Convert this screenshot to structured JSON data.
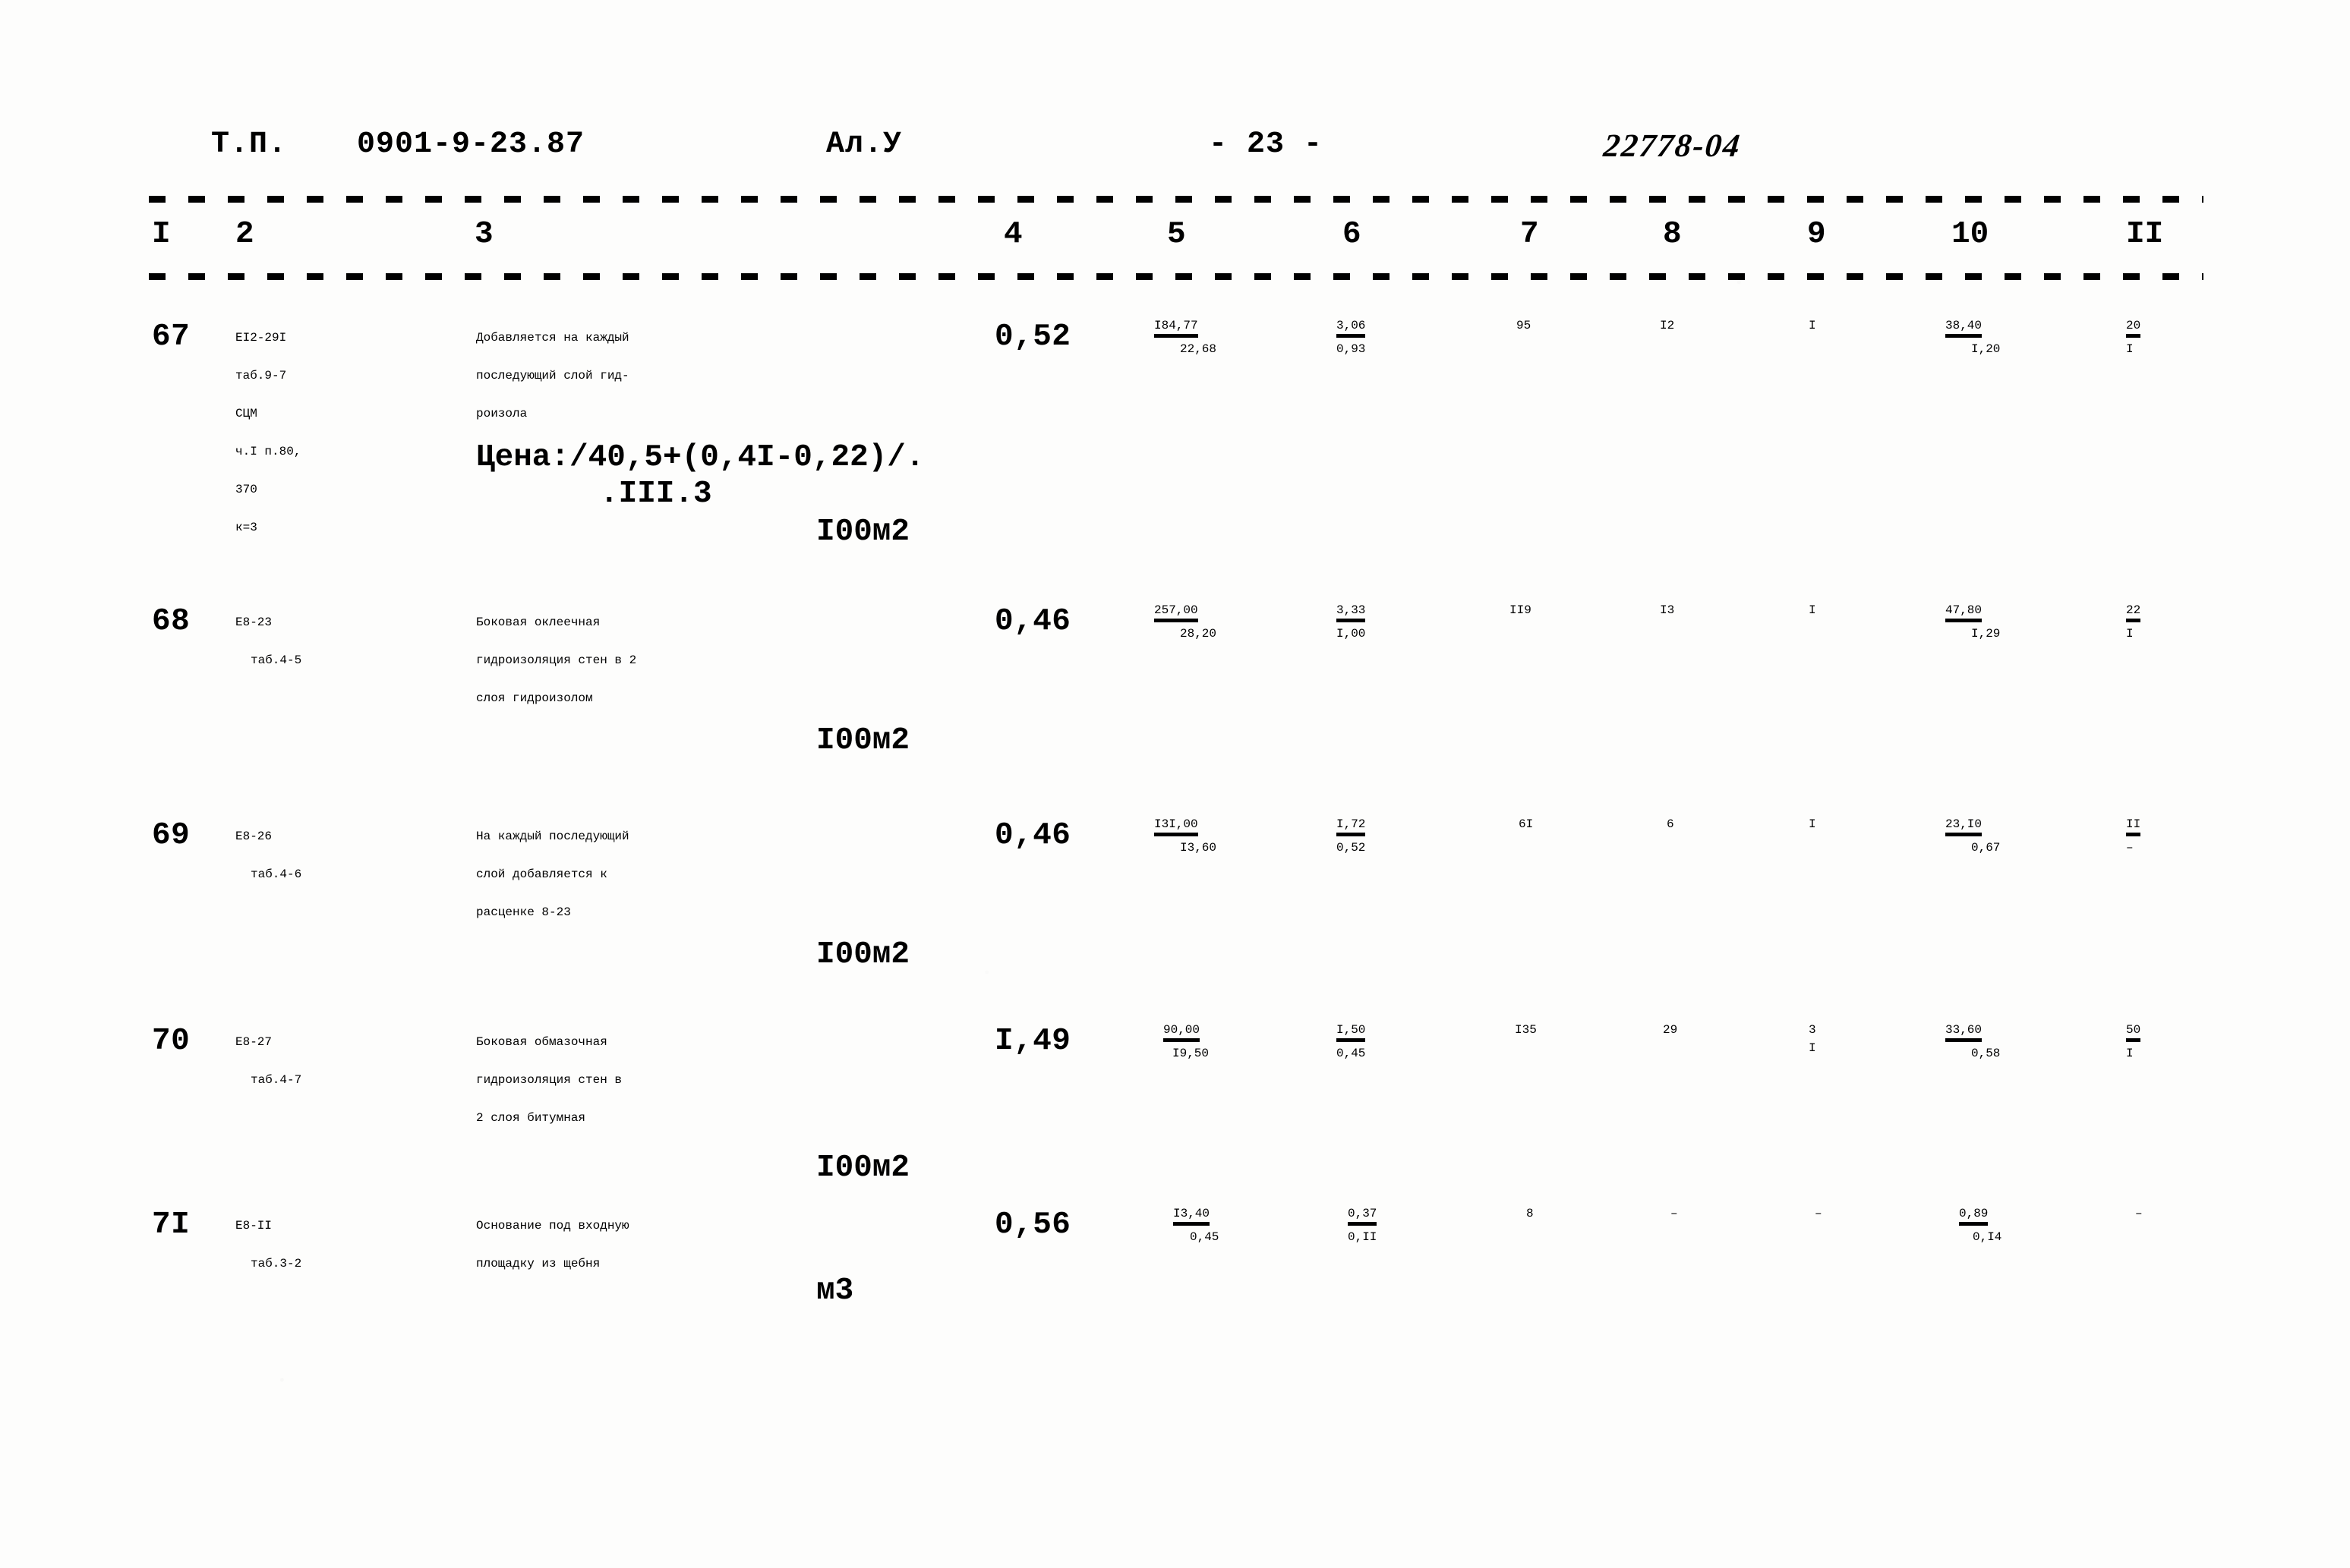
{
  "document": {
    "type_label": "Т.П.",
    "project_code": "0901-9-23.87",
    "album": "Ал.У",
    "page_marker": "- 23 -",
    "archive_stamp": "22778-04"
  },
  "table": {
    "column_numbers": [
      "I",
      "2",
      "3",
      "4",
      "5",
      "6",
      "7",
      "8",
      "9",
      "10",
      "II"
    ],
    "rows": [
      {
        "no": "67",
        "code_lines": [
          "ЕI2-29I",
          "таб.9-7",
          "СЦМ",
          "ч.I п.80,",
          "370",
          "к=3"
        ],
        "description_lines": [
          "Добавляется на каждый",
          "последующий слой гид-",
          "роизола"
        ],
        "price_note": "Цена:/40,5+(0,4I-0,22)/.",
        "price_note2": ".III.3",
        "unit": "I00м2",
        "c4": "0,52",
        "c5_top": "I84,77",
        "c5_bot": "22,68",
        "c6_top": "3,06",
        "c6_bot": "0,93",
        "c7_top": "95",
        "c7_bot": "",
        "c8_top": "I2",
        "c8_bot": "",
        "c9_top": "I",
        "c9_bot": "",
        "c10_top": "38,40",
        "c10_bot": "I,20",
        "c11_top": "20",
        "c11_bot": "I"
      },
      {
        "no": "68",
        "code_lines": [
          "Е8-23",
          "таб.4-5"
        ],
        "description_lines": [
          "Боковая оклеечная",
          "гидроизоляция стен в 2",
          "слоя гидроизолом"
        ],
        "price_note": "",
        "price_note2": "",
        "unit": "I00м2",
        "c4": "0,46",
        "c5_top": "257,00",
        "c5_bot": "28,20",
        "c6_top": "3,33",
        "c6_bot": "I,00",
        "c7_top": "II9",
        "c7_bot": "",
        "c8_top": "I3",
        "c8_bot": "",
        "c9_top": "I",
        "c9_bot": "",
        "c10_top": "47,80",
        "c10_bot": "I,29",
        "c11_top": "22",
        "c11_bot": "I"
      },
      {
        "no": "69",
        "code_lines": [
          "Е8-26",
          "таб.4-6"
        ],
        "description_lines": [
          "На каждый последующий",
          "слой добавляется к",
          "расценке 8-23"
        ],
        "price_note": "",
        "price_note2": "",
        "unit": "I00м2",
        "c4": "0,46",
        "c5_top": "I3I,00",
        "c5_bot": "I3,60",
        "c6_top": "I,72",
        "c6_bot": "0,52",
        "c7_top": "6I",
        "c7_bot": "",
        "c8_top": "6",
        "c8_bot": "",
        "c9_top": "I",
        "c9_bot": "",
        "c10_top": "23,I0",
        "c10_bot": "0,67",
        "c11_top": "II",
        "c11_bot": "–"
      },
      {
        "no": "70",
        "code_lines": [
          "Е8-27",
          "таб.4-7"
        ],
        "description_lines": [
          "Боковая обмазочная",
          "гидроизоляция стен в",
          "2 слоя битумная"
        ],
        "price_note": "",
        "price_note2": "",
        "unit": "I00м2",
        "c4": "I,49",
        "c5_top": "90,00",
        "c5_bot": "I9,50",
        "c6_top": "I,50",
        "c6_bot": "0,45",
        "c7_top": "I35",
        "c7_bot": "",
        "c8_top": "29",
        "c8_bot": "",
        "c9_top": "3",
        "c9_bot": "I",
        "c10_top": "33,60",
        "c10_bot": "0,58",
        "c11_top": "50",
        "c11_bot": "I"
      },
      {
        "no": "7I",
        "code_lines": [
          "Е8-II",
          "таб.3-2"
        ],
        "description_lines": [
          "Основание под входную",
          "площадку из щебня"
        ],
        "price_note": "",
        "price_note2": "",
        "unit": "м3",
        "c4": "0,56",
        "c5_top": "I3,40",
        "c5_bot": "0,45",
        "c6_top": "0,37",
        "c6_bot": "0,II",
        "c7_top": "8",
        "c7_bot": "",
        "c8_top": "–",
        "c8_bot": "",
        "c9_top": "–",
        "c9_bot": "",
        "c10_top": "0,89",
        "c10_bot": "0,I4",
        "c11_top": "–",
        "c11_bot": ""
      }
    ]
  }
}
